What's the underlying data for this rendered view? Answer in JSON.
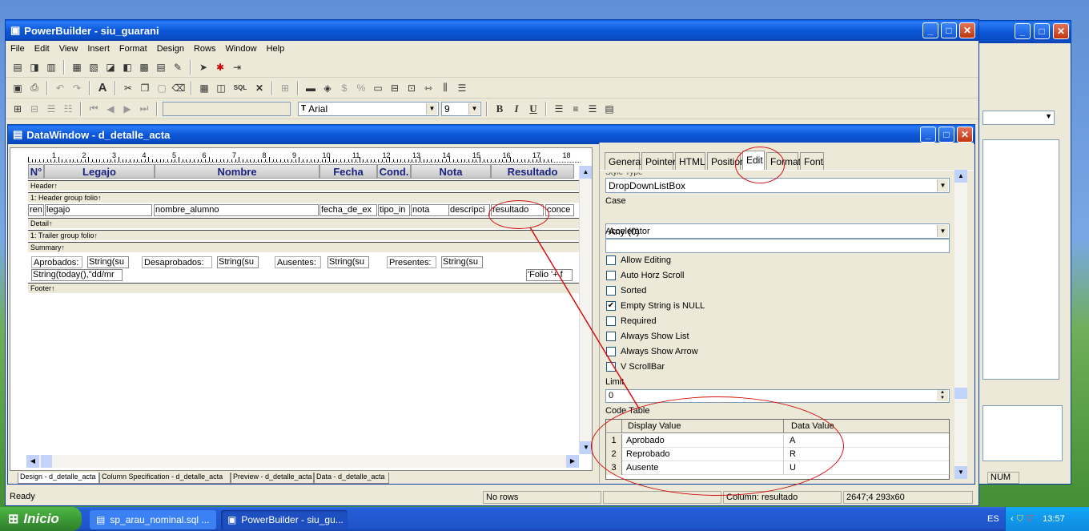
{
  "app": {
    "title": "PowerBuilder - siu_guarani"
  },
  "menu": [
    "File",
    "Edit",
    "View",
    "Insert",
    "Format",
    "Design",
    "Rows",
    "Window",
    "Help"
  ],
  "font_toolbar": {
    "font": "Arial",
    "size": "9",
    "bold": "B",
    "italic": "I",
    "underline": "U"
  },
  "toolbar": {
    "sql": "SQL"
  },
  "datawindow": {
    "title": "DataWindow - d_detalle_acta"
  },
  "ruler": [
    "1",
    "2",
    "3",
    "4",
    "5",
    "6",
    "7",
    "8",
    "9",
    "10",
    "11",
    "12",
    "13",
    "14",
    "15",
    "16",
    "17",
    "18"
  ],
  "columns": [
    "N°",
    "Legajo",
    "Nombre",
    "Fecha",
    "Cond.",
    "Nota",
    "Resultado"
  ],
  "bands": {
    "header": "Header↑",
    "header_group": "1: Header group folio↑",
    "detail": "Detail↑",
    "trailer": "1: Trailer group folio↑",
    "summary": "Summary↑",
    "footer": "Footer↑"
  },
  "detail_fields": [
    "ren",
    "legajo",
    "nombre_alumno",
    "fecha_de_ex",
    "tipo_in",
    "nota",
    "descripci",
    "resultado",
    "conce"
  ],
  "summary": {
    "aprobados_label": "Aprobados:",
    "aprobados_val": "String(su",
    "desaprobados_label": "Desaprobados:",
    "desaprobados_val": "String(su",
    "ausentes_label": "Ausentes:",
    "ausentes_val": "String(su",
    "presentes_label": "Presentes:",
    "presentes_val": "String(su",
    "today": "String(today(),\"dd/mr",
    "folio": "'Folio  '+ f"
  },
  "bottom_tabs": [
    "Design - d_detalle_acta",
    "Column Specification - d_detalle_acta",
    "Preview - d_detalle_acta",
    "Data - d_detalle_acta"
  ],
  "props": {
    "tabs": [
      "General",
      "Pointer",
      "HTML",
      "Position",
      "Edit",
      "Format",
      "Font"
    ],
    "style_type_label": "Style Type",
    "style_type": "DropDownListBox",
    "case_label": "Case",
    "case": "Any (0)",
    "accelerator_label": "Accelerator",
    "checks": [
      {
        "label": "Allow Editing",
        "checked": false
      },
      {
        "label": "Auto Horz Scroll",
        "checked": false
      },
      {
        "label": "Sorted",
        "checked": false
      },
      {
        "label": "Empty String is NULL",
        "checked": true
      },
      {
        "label": "Required",
        "checked": false
      },
      {
        "label": "Always Show List",
        "checked": false
      },
      {
        "label": "Always Show Arrow",
        "checked": false
      },
      {
        "label": "V ScrollBar",
        "checked": false
      }
    ],
    "limit_label": "Limit",
    "limit": "0",
    "code_table_label": "Code Table",
    "code_headers": [
      "Display Value",
      "Data Value"
    ],
    "code_rows": [
      {
        "n": "1",
        "display": "Aprobado",
        "data": "A"
      },
      {
        "n": "2",
        "display": "Reprobado",
        "data": "R"
      },
      {
        "n": "3",
        "display": "Ausente",
        "data": "U"
      }
    ]
  },
  "status": {
    "ready": "Ready",
    "rows": "No rows",
    "column": "Column: resultado",
    "pos": "2647;4 293x60",
    "num": "NUM"
  },
  "taskbar": {
    "start": "Inicio",
    "task1": "sp_arau_nominal.sql ...",
    "task2": "PowerBuilder - siu_gu...",
    "lang": "ES",
    "clock": "13:57"
  },
  "colors": {
    "titlebar": "#0a5fe8",
    "start": "#3c9a36",
    "annotation": "#d41010"
  }
}
